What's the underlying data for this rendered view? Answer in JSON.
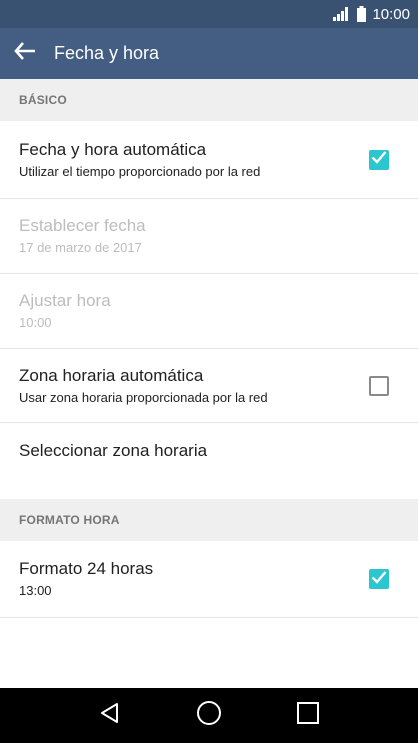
{
  "status_bar": {
    "time": "10:00",
    "icons": [
      "signal-icon",
      "battery-icon"
    ]
  },
  "app_bar": {
    "title": "Fecha y hora",
    "back_icon": "arrow-left-icon"
  },
  "sections": {
    "basic_header": "BÁSICO",
    "format_header": "FORMATO HORA"
  },
  "settings": {
    "auto_date": {
      "title": "Fecha y hora automática",
      "subtitle": "Utilizar el tiempo proporcionado por la red",
      "checked": true
    },
    "set_date": {
      "title": "Establecer fecha",
      "subtitle": "17 de marzo de 2017",
      "enabled": false
    },
    "set_time": {
      "title": "Ajustar hora",
      "subtitle": "10:00",
      "enabled": false
    },
    "auto_timezone": {
      "title": "Zona horaria automática",
      "subtitle": "Usar zona horaria proporcionada por la red",
      "checked": false
    },
    "select_timezone": {
      "title": "Seleccionar zona horaria"
    },
    "format_24h": {
      "title": "Formato 24 horas",
      "subtitle": "13:00",
      "checked": true
    }
  },
  "colors": {
    "status_bar": "#3a5272",
    "app_bar": "#445d82",
    "accent": "#2cc6d0",
    "section_bg": "#efefef"
  },
  "nav_bar": {
    "icons": [
      "back-triangle-icon",
      "home-circle-icon",
      "recents-square-icon"
    ]
  }
}
